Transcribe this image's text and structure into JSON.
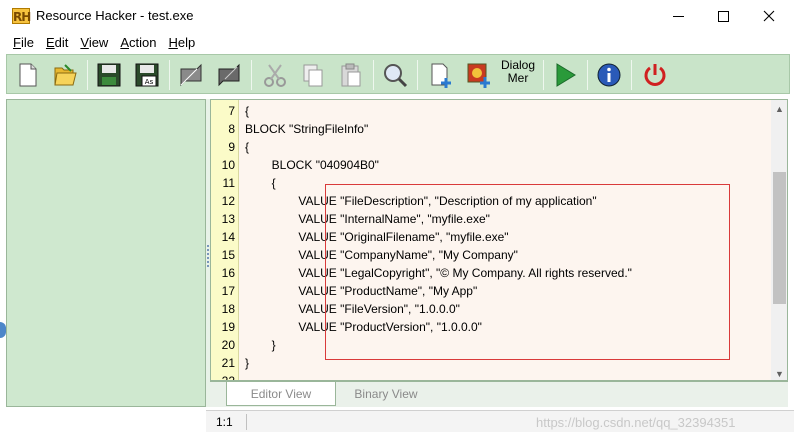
{
  "window": {
    "app_icon_text": "RH",
    "title": "Resource Hacker - test.exe"
  },
  "menu": [
    {
      "label": "File",
      "accel": "F",
      "rest": "ile"
    },
    {
      "label": "Edit",
      "accel": "E",
      "rest": "dit"
    },
    {
      "label": "View",
      "accel": "V",
      "rest": "iew"
    },
    {
      "label": "Action",
      "accel": "A",
      "rest": "ction"
    },
    {
      "label": "Help",
      "accel": "H",
      "rest": "elp"
    }
  ],
  "toolbar": {
    "dialog_menu_label_line1": "Dialog",
    "dialog_menu_label_line2": "Mer",
    "buttons": [
      "new-file",
      "open",
      "save",
      "save-as",
      "compile-back",
      "compile-forward",
      "cut",
      "copy",
      "paste",
      "find",
      "add-resource",
      "add-image",
      "dialog-menu",
      "run",
      "info",
      "exit"
    ]
  },
  "editor": {
    "line_numbers": [
      "7",
      "8",
      "9",
      "10",
      "11",
      "12",
      "13",
      "14",
      "15",
      "16",
      "17",
      "18",
      "19",
      "20",
      "21",
      "22"
    ],
    "lines": [
      "{",
      "BLOCK \"StringFileInfo\"",
      "{",
      "        BLOCK \"040904B0\"",
      "        {",
      "                VALUE \"FileDescription\", \"Description of my application\"",
      "                VALUE \"InternalName\", \"myfile.exe\"",
      "                VALUE \"OriginalFilename\", \"myfile.exe\"",
      "                VALUE \"CompanyName\", \"My Company\"",
      "                VALUE \"LegalCopyright\", \"© My Company. All rights reserved.\"",
      "                VALUE \"ProductName\", \"My App\"",
      "                VALUE \"FileVersion\", \"1.0.0.0\"",
      "                VALUE \"ProductVersion\", \"1.0.0.0\"",
      "        }",
      "}",
      ""
    ]
  },
  "tabs": {
    "editor_view": "Editor View",
    "binary_view": "Binary View"
  },
  "status": {
    "position": "1:1",
    "watermark": "https://blog.csdn.net/qq_32394351"
  },
  "colors": {
    "toolbar_bg": "#c9e4c9",
    "left_pane_bg": "#cfe8cf",
    "editor_bg": "#fdf5ef",
    "gutter_bg": "#fbfbc8",
    "highlight_box": "#d93a3a"
  }
}
